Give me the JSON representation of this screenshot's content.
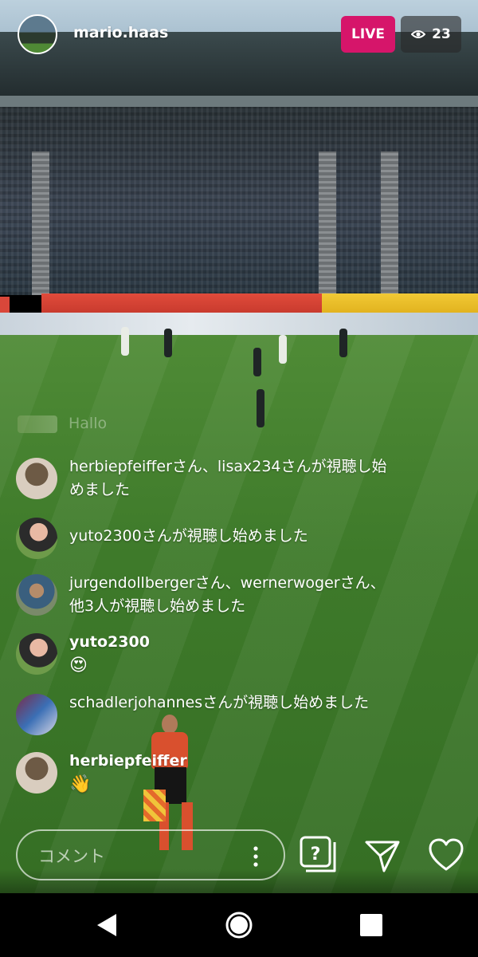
{
  "host": {
    "username": "mario.haas",
    "avatar_icon": "team-photo-avatar"
  },
  "live": {
    "badge_label": "LIVE",
    "badge_color": "#d6156a",
    "viewer_icon": "eye-icon",
    "viewer_count": "23"
  },
  "comments": {
    "faded": {
      "text": "Hallo"
    },
    "items": [
      {
        "type": "joined",
        "text": "herbiepfeifferさん、lisax234さんが視聴し始めました",
        "avatar_icon": "user-avatar"
      },
      {
        "type": "joined",
        "text": "yuto2300さんが視聴し始めました",
        "avatar_icon": "user-avatar"
      },
      {
        "type": "joined",
        "text": "jurgendollbergerさん、wernerwogerさん、他3人が視聴し始めました",
        "avatar_icon": "user-avatar"
      },
      {
        "type": "comment",
        "user": "yuto2300",
        "body": "😍",
        "avatar_icon": "user-avatar"
      },
      {
        "type": "joined",
        "text": "schadlerjohannesさんが視聴し始めました",
        "avatar_icon": "user-avatar"
      },
      {
        "type": "comment",
        "user": "herbiepfeiffer",
        "body": "👋",
        "avatar_icon": "user-avatar"
      }
    ]
  },
  "composer": {
    "placeholder": "コメント",
    "more_icon": "more-vertical-icon",
    "question_icon": "question-icon",
    "send_icon": "send-icon",
    "like_icon": "heart-icon"
  },
  "system_nav": {
    "back_icon": "back-icon",
    "home_icon": "home-icon",
    "recents_icon": "recents-icon"
  }
}
